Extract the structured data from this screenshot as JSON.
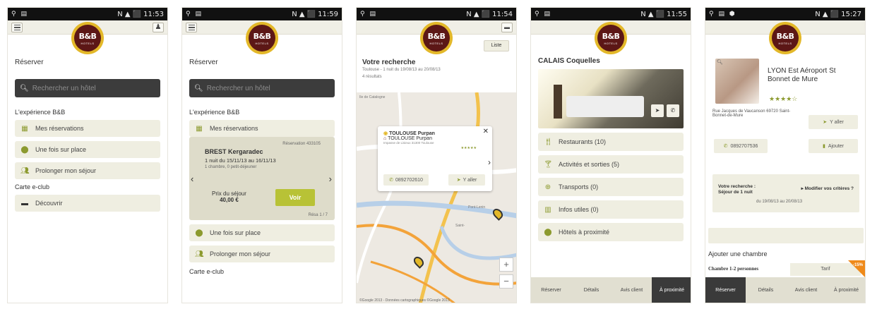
{
  "brand": {
    "logo_text": "B&B",
    "logo_sub": "HOTELS",
    "maroon": "#5c1716",
    "gold": "#e3b829",
    "accent_green": "#8c9a2f",
    "voir_green": "#b8c236"
  },
  "status_times": [
    "11:53",
    "11:59",
    "11:54",
    "11:55",
    "15:27"
  ],
  "status_icons": "N",
  "screen1": {
    "title": "Réserver",
    "search_placeholder": "Rechercher un hôtel",
    "section": "L'expérience B&B",
    "items": [
      "Mes réservations",
      "Une fois sur place",
      "Prolonger mon séjour"
    ],
    "club_section": "Carte e-club",
    "club_item": "Découvrir"
  },
  "screen2": {
    "title": "Réserver",
    "search_placeholder": "Rechercher un hôtel",
    "section": "L'expérience B&B",
    "item_reservations": "Mes réservations",
    "reservation": {
      "number": "Réservation 433105",
      "city": "BREST Kergaradec",
      "dates": "1 nuit du 15/11/13 au 16/11/13",
      "rooms": "1 chambre, 0 petit-déjeuner",
      "price_label": "Prix du séjour",
      "price": "40,00 €",
      "button": "Voir",
      "pager": "Résa 1 / 7"
    },
    "items": [
      "Une fois sur place",
      "Prolonger mon séjour"
    ],
    "club_section": "Carte e-club"
  },
  "screen3": {
    "title": "Votre recherche",
    "subtitle": "Toulouse - 1 nuit du 19/08/13 au 20/08/13",
    "results": "4 résultats",
    "list_button": "Liste",
    "popup": {
      "title": "TOULOUSE Purpan",
      "title2": "TOULOUSE Purpan",
      "address": "Impasse de Lisieux 31300 Toulouse",
      "phone": "0892702610",
      "goto": "Y aller",
      "stars": "★★★★★"
    },
    "map_labels": [
      "Ile de Catalogne",
      "Pont-Lenin",
      "Saint-"
    ],
    "copyright": "©Google 2013 - Données cartographiques ©Google 2013"
  },
  "screen4": {
    "title": "CALAIS Coquelles",
    "items": [
      "Restaurants (10)",
      "Activités et sorties (5)",
      "Transports (0)",
      "Infos utiles (0)",
      "Hôtels à proximité"
    ],
    "tabs": [
      "Réserver",
      "Détails",
      "Avis client",
      "À proximité"
    ],
    "active_tab": 3
  },
  "screen5": {
    "hotel_name": "LYON Est Aéroport St Bonnet de Mure",
    "stars": "★★★★☆",
    "address": "Rue Jacques de Vaucanson 69720 Saint-Bonnet-de-Mure",
    "goto": "Y aller",
    "phone": "0892707536",
    "add": "Ajouter",
    "recap_l1": "Votre recherche :",
    "recap_l2": "Séjour de 1 nuit",
    "modify": "▸ Modifier vos critères ?",
    "recap_dates": "du 19/08/13 au 20/08/13",
    "add_room": "Ajouter une chambre",
    "room_type": "Chambre 1-2 personnes",
    "tarif": "Tarif",
    "promo": "-15%",
    "tabs": [
      "Réserver",
      "Détails",
      "Avis client",
      "À proximité"
    ],
    "active_tab": 0
  }
}
